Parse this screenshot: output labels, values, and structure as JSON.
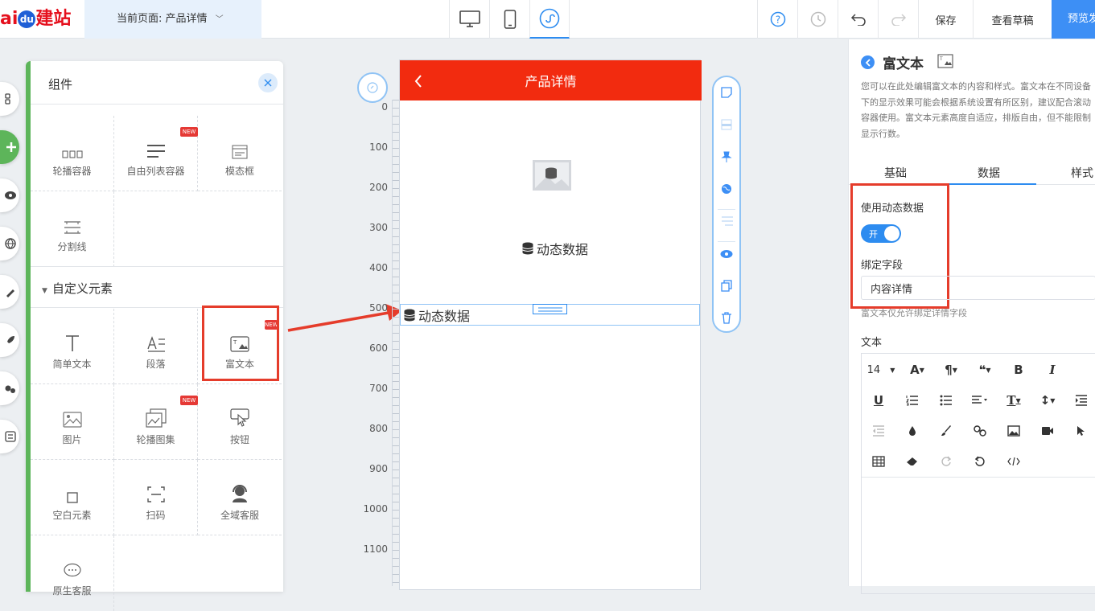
{
  "topbar": {
    "logo_a": "ai",
    "logo_paw": "du",
    "logo_b": "建站",
    "current_page": "当前页面: 产品详情",
    "save": "保存",
    "view_draft": "查看草稿",
    "preview": "预览发布"
  },
  "panel": {
    "title": "组件",
    "section_custom": "自定义元素",
    "new_tag": "NEW",
    "items_row1": [
      "轮播容器",
      "自由列表容器",
      "模态框"
    ],
    "item_divider": "分割线",
    "custom_items": [
      "简单文本",
      "段落",
      "富文本",
      "图片",
      "轮播图集",
      "按钮",
      "空白元素",
      "扫码",
      "全域客服",
      "原生客服"
    ]
  },
  "ruler": [
    "0",
    "100",
    "200",
    "300",
    "400",
    "500",
    "600",
    "700",
    "800",
    "900",
    "1000",
    "1100"
  ],
  "phone": {
    "header": "产品详情",
    "dynamic_label": "动态数据",
    "richtext_dynamic": "动态数据"
  },
  "right": {
    "title": "富文本",
    "desc": "您可以在此处编辑富文本的内容和样式。富文本在不同设备下的显示效果可能会根据系统设置有所区别，建议配合滚动容器使用。富文本元素高度自适应，排版自由，但不能限制显示行数。",
    "tabs": [
      "基础",
      "数据",
      "样式"
    ],
    "use_dynamic": "使用动态数据",
    "toggle_label": "开",
    "bind_field": "绑定字段",
    "bind_value": "内容详情",
    "bind_hint": "富文本仅允许绑定详情字段",
    "text_label": "文本",
    "font_size": "14"
  },
  "colors": {
    "accent": "#2d8cf0",
    "brand_red": "#f22b0f",
    "highlight": "#e53c2b",
    "green": "#5db55a"
  }
}
